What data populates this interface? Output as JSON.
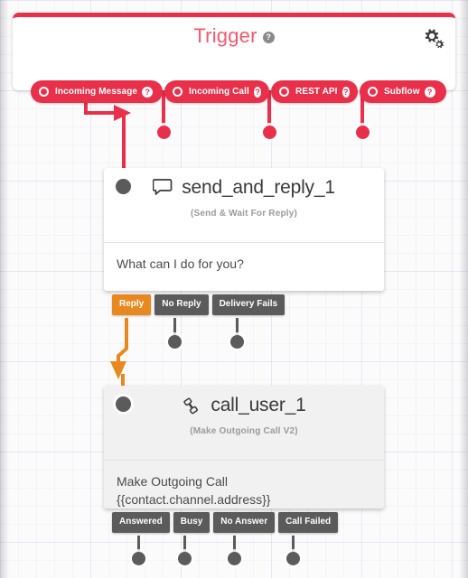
{
  "panel": {
    "title": "Trigger",
    "help_badge": "?",
    "gear_icon": "gear-icon",
    "accent_color": "#e8304a",
    "title_color": "#ed5a6e",
    "triggers": [
      {
        "label": "Incoming Message",
        "help": "?",
        "icon": "circle-ring-icon"
      },
      {
        "label": "Incoming Call",
        "help": "?",
        "icon": "circle-ring-icon"
      },
      {
        "label": "REST API",
        "help": "?",
        "icon": "circle-ring-icon"
      },
      {
        "label": "Subflow",
        "help": "?",
        "icon": "circle-ring-icon"
      }
    ]
  },
  "nodes": [
    {
      "id": "send_and_reply_1",
      "title": "send_and_reply_1",
      "subtitle": "(Send & Wait For Reply)",
      "icon": "chat-bubble-icon",
      "body_lines": [
        "What can I do for you?"
      ],
      "outputs": [
        {
          "label": "Reply",
          "active": true
        },
        {
          "label": "No Reply",
          "active": false
        },
        {
          "label": "Delivery Fails",
          "active": false
        }
      ]
    },
    {
      "id": "call_user_1",
      "title": "call_user_1",
      "subtitle": "(Make Outgoing Call V2)",
      "icon": "phone-icon",
      "body_lines": [
        "Make Outgoing Call",
        "{{contact.channel.address}}"
      ],
      "outputs": [
        {
          "label": "Answered",
          "active": false
        },
        {
          "label": "Busy",
          "active": false
        },
        {
          "label": "No Answer",
          "active": false
        },
        {
          "label": "Call Failed",
          "active": false
        }
      ]
    }
  ],
  "connectors": {
    "trigger_color": "#e8304a",
    "active_path_color": "#e8891f",
    "default_color": "#5b5b5b"
  }
}
